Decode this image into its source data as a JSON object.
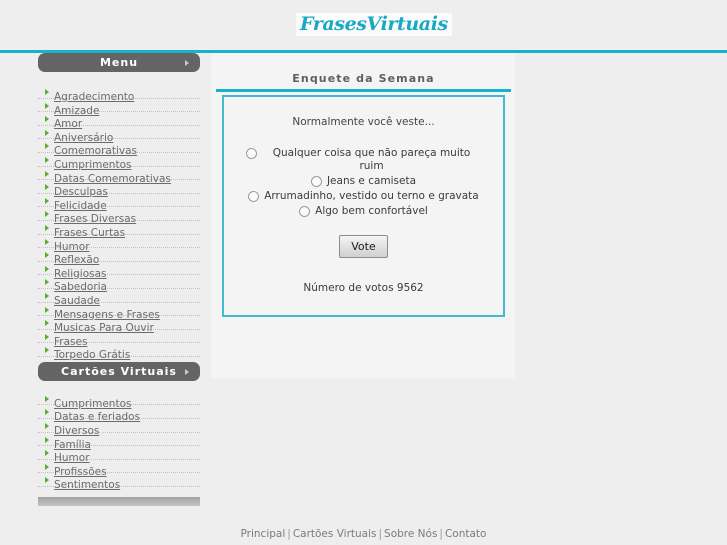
{
  "site": {
    "logo": "FrasesVirtuais",
    "accent_color": "#19b2cd",
    "menu_header_color": "#646464",
    "bullet_color": "#5aad2a"
  },
  "sidebar": {
    "menu_header": "Menu",
    "menu_items": [
      "Agradecimento",
      "Amizade",
      "Amor",
      "Aniversário",
      "Comemorativas",
      "Cumprimentos",
      "Datas Comemorativas",
      "Desculpas",
      "Felicidade",
      "Frases Diversas",
      "Frases Curtas",
      "Humor",
      "Reflexão",
      "Religiosas",
      "Sabedoria",
      "Saudade",
      "Mensagens e Frases",
      "Musicas Para Ouvir",
      "Frases",
      "Torpedo Grátis"
    ],
    "cards_header": "Cartões Virtuais",
    "cards_items": [
      "Cumprimentos",
      "Datas e feriados",
      "Diversos",
      "Família",
      "Humor",
      "Profissões",
      "Sentimentos"
    ]
  },
  "poll": {
    "title": "Enquete da Semana",
    "question": "Normalmente você veste...",
    "options": [
      "Qualquer coisa que não pareça muito ruim",
      "Jeans e camiseta",
      "Arrumadinho, vestido ou terno e gravata",
      "Algo bem confortável"
    ],
    "vote_button": "Vote",
    "votes_label": "Número de votos 9562",
    "votes_count": 9562
  },
  "footer": {
    "links": [
      "Principal",
      "Cartões Virtuais",
      "Sobre Nós",
      "Contato"
    ],
    "separator": "|"
  }
}
